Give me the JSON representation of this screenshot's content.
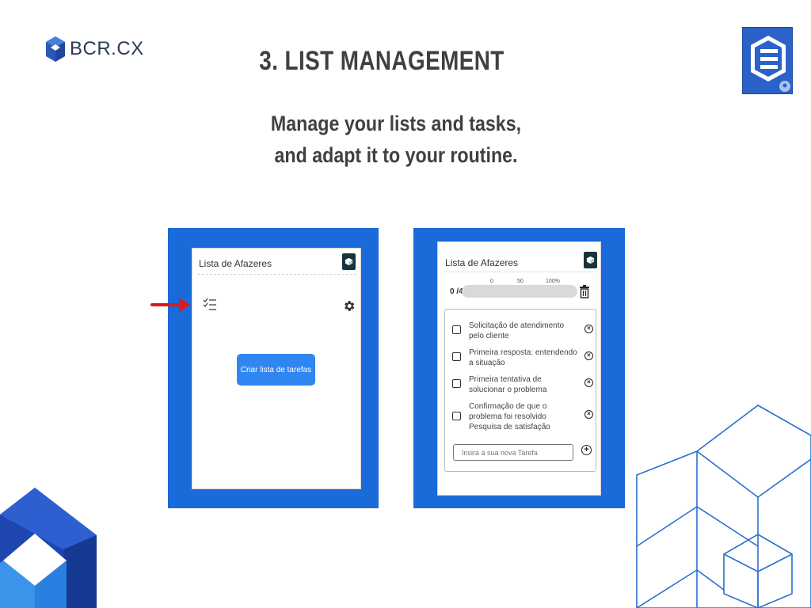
{
  "brand": {
    "logo_text": "BCR.CX"
  },
  "slide": {
    "title": "3. LIST MANAGEMENT",
    "subtitle_line1": "Manage your lists and tasks,",
    "subtitle_line2": "and adapt it to your routine."
  },
  "left_panel": {
    "card_title": "Lista de Afazeres",
    "create_button": "Criar lista de tarefas"
  },
  "right_panel": {
    "card_title": "Lista de Afazeres",
    "progress": {
      "count": "0 /4",
      "value": 0,
      "ticks": [
        "0",
        "50",
        "100%"
      ]
    },
    "tasks": [
      {
        "label": "Solicitação de atendimento pelo cliente",
        "checked": false
      },
      {
        "label": "Primeira resposta: entendendo a situação",
        "checked": false
      },
      {
        "label": "Primeira tentativa de solucionar o problema",
        "checked": false
      },
      {
        "label": "Confirmação de que o problema foi resolvido Pesquisa de satisfação",
        "checked": false
      }
    ],
    "new_task_placeholder": "Insira a sua nova Tarefa"
  },
  "colors": {
    "accent_blue": "#1b6ad9",
    "button_blue": "#2f86f0",
    "arrow_red": "#e01818",
    "dark_teal": "#17343a",
    "title_gray": "#404040"
  }
}
